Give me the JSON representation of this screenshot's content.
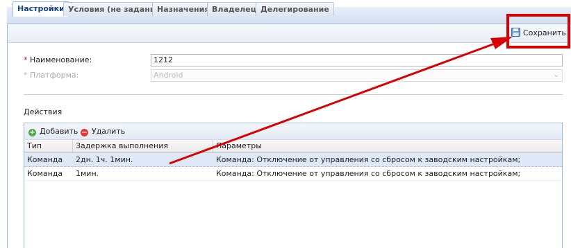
{
  "tabs": [
    {
      "label": "Настройки",
      "active": true
    },
    {
      "label": "Условия (не заданы)",
      "active": false
    },
    {
      "label": "Назначения",
      "active": false
    },
    {
      "label": "Владелец",
      "active": false
    },
    {
      "label": "Делегирование",
      "active": false
    }
  ],
  "toolbar": {
    "save_label": "Сохранить"
  },
  "form": {
    "name": {
      "label": "Наименование:",
      "value": "1212",
      "required_mark": "*"
    },
    "platform": {
      "label": "Платформа:",
      "value": "Android",
      "required_mark": "*"
    }
  },
  "actions": {
    "title": "Действия",
    "add_label": "Добавить",
    "delete_label": "Удалить",
    "columns": [
      "Тип",
      "Задержка выполнения",
      "Параметры"
    ],
    "rows": [
      [
        "Команда",
        "2дн. 1ч. 1мин.",
        "Команда: Отключение от управления со сбросом к заводским настройкам;"
      ],
      [
        "Команда",
        "1мин.",
        "Команда: Отключение от управления со сбросом к заводским настройкам;"
      ]
    ],
    "selected_row": 0
  },
  "colors": {
    "accent": "#15428b",
    "annotation": "#d80000"
  }
}
